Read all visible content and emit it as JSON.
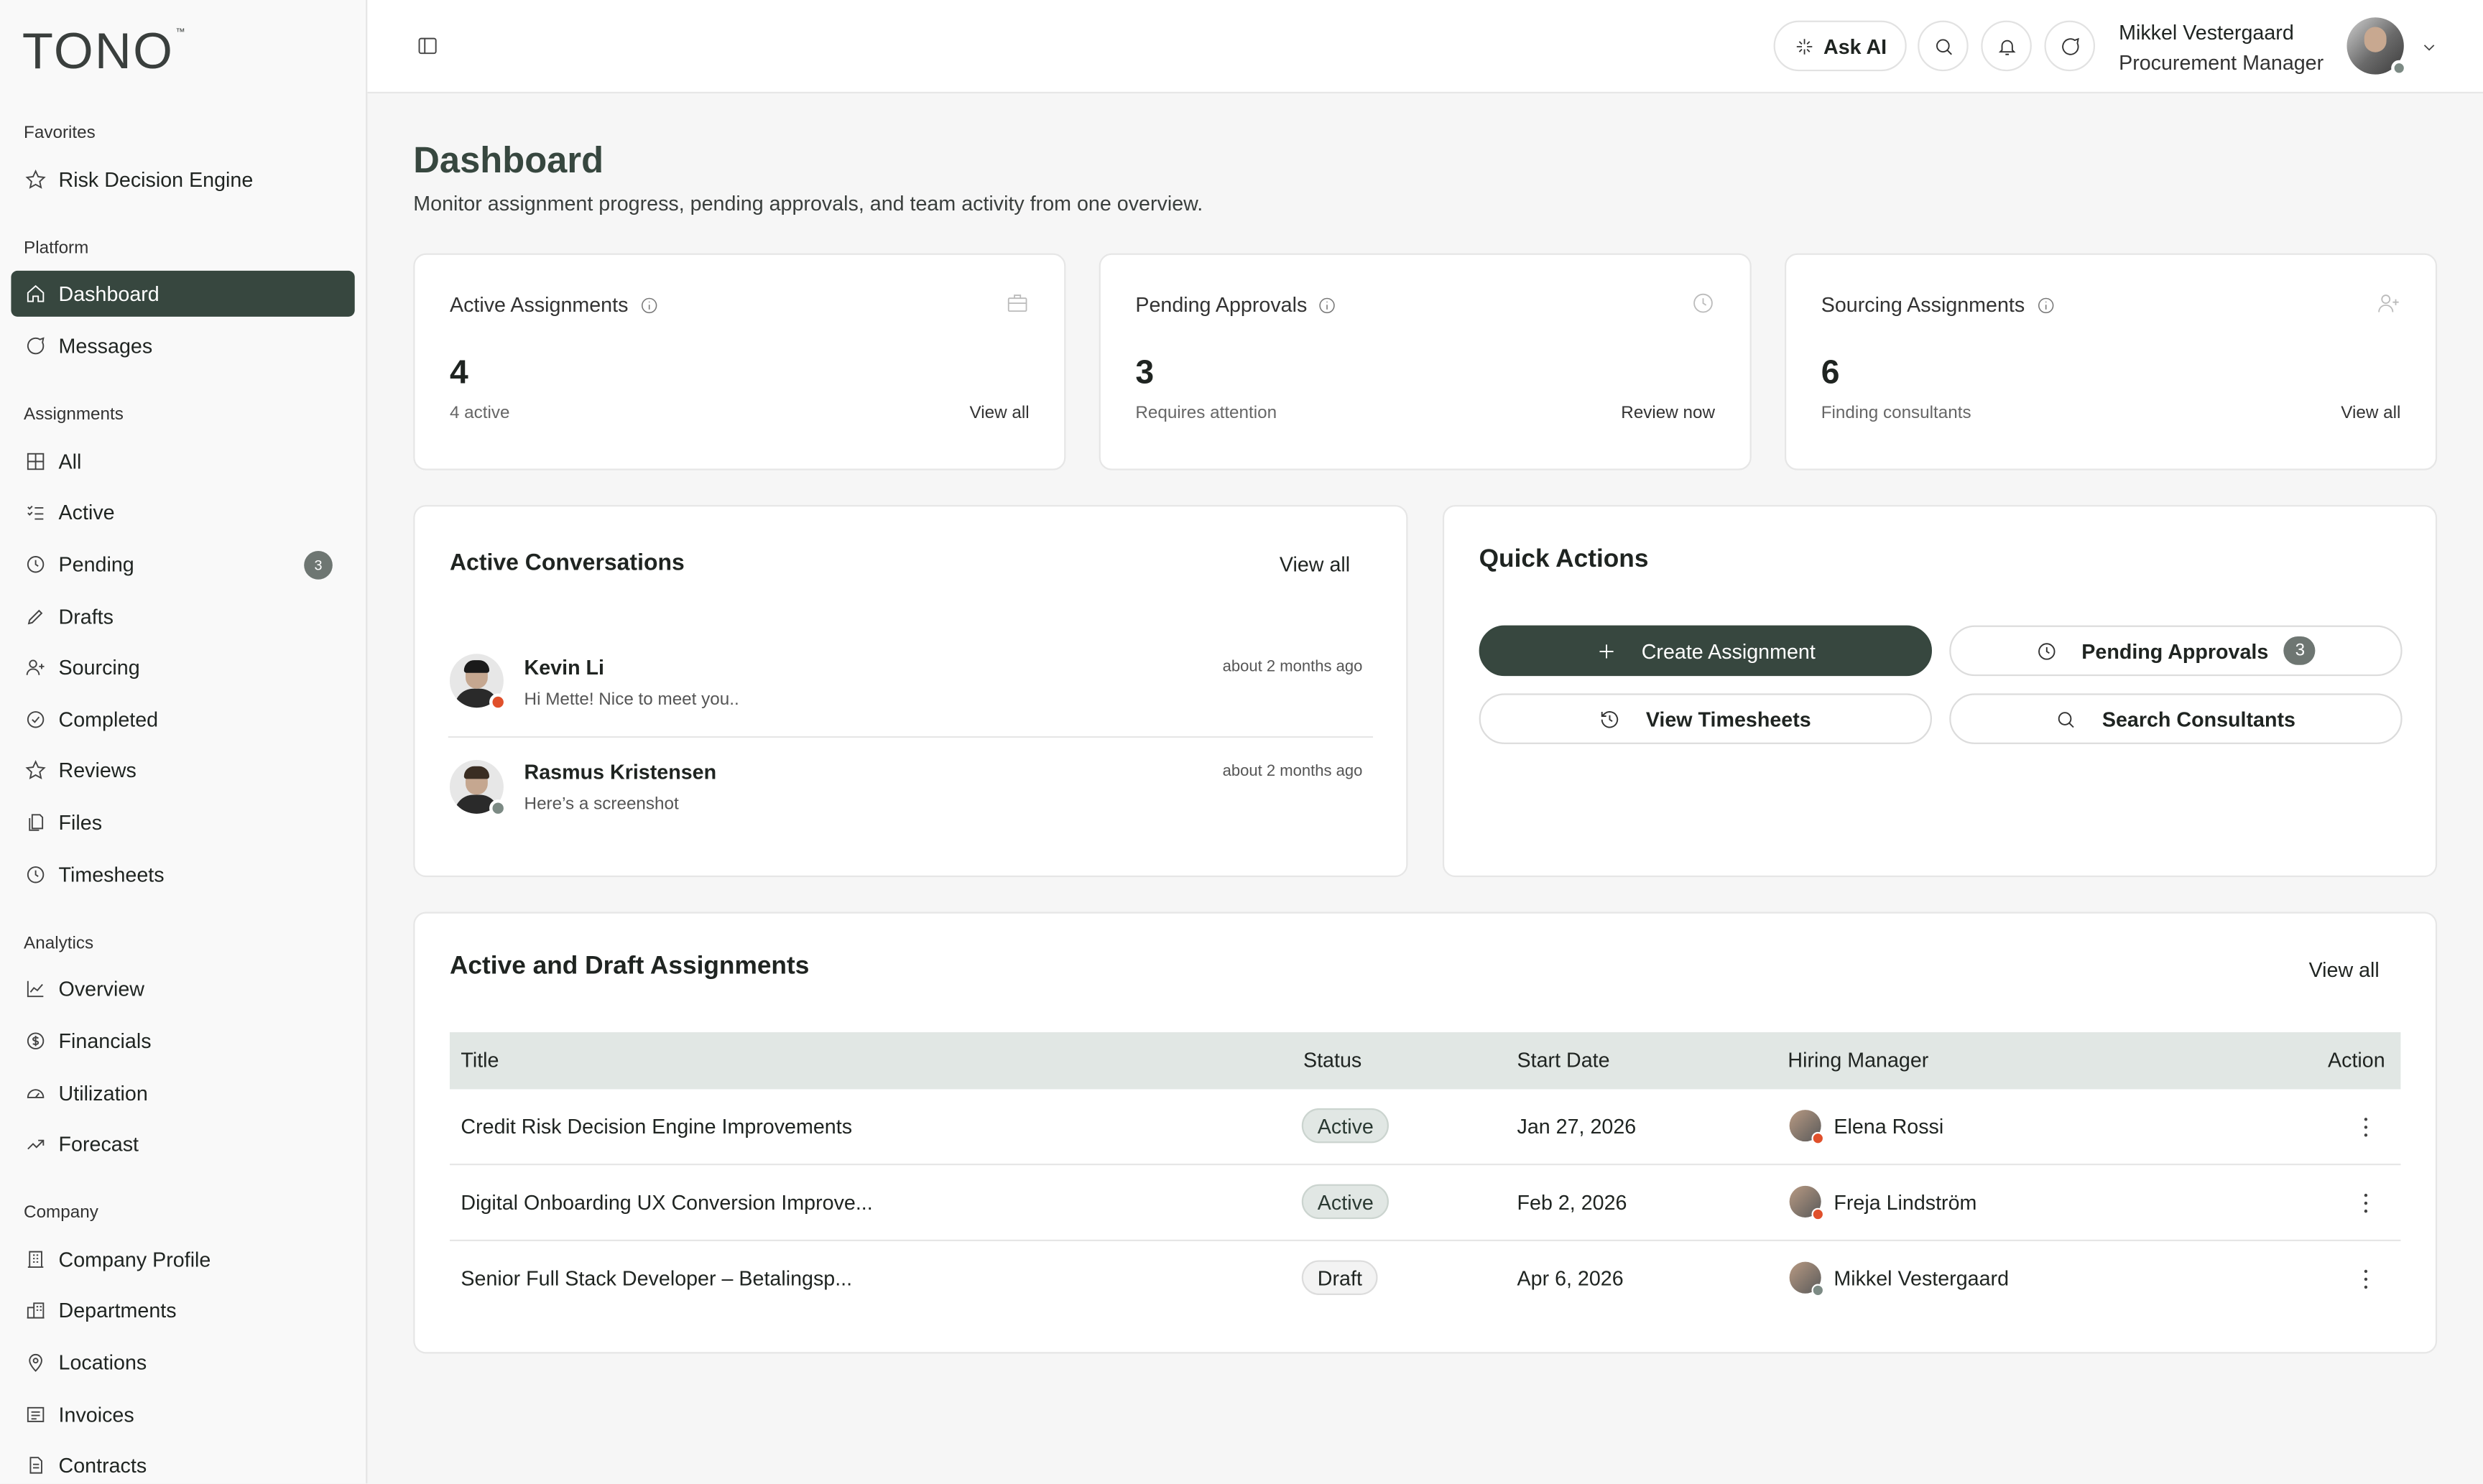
{
  "app": {
    "logo": "TONO",
    "logo_mark": "™"
  },
  "sidebar": {
    "sections": {
      "favorites": "Favorites",
      "platform": "Platform",
      "assignments": "Assignments",
      "analytics": "Analytics",
      "company": "Company"
    },
    "favorites": [
      {
        "label": "Risk Decision Engine",
        "icon": "star-icon"
      }
    ],
    "platform": [
      {
        "label": "Dashboard",
        "icon": "home-icon",
        "active": true
      },
      {
        "label": "Messages",
        "icon": "message-icon"
      }
    ],
    "assignments": [
      {
        "label": "All",
        "icon": "grid-icon"
      },
      {
        "label": "Active",
        "icon": "list-check-icon"
      },
      {
        "label": "Pending",
        "icon": "clock-icon",
        "badge": "3"
      },
      {
        "label": "Drafts",
        "icon": "pencil-icon"
      },
      {
        "label": "Sourcing",
        "icon": "user-plus-icon"
      },
      {
        "label": "Completed",
        "icon": "check-circle-icon"
      },
      {
        "label": "Reviews",
        "icon": "star-icon"
      },
      {
        "label": "Files",
        "icon": "files-icon"
      },
      {
        "label": "Timesheets",
        "icon": "clock-icon"
      }
    ],
    "analytics": [
      {
        "label": "Overview",
        "icon": "line-chart-icon"
      },
      {
        "label": "Financials",
        "icon": "dollar-icon"
      },
      {
        "label": "Utilization",
        "icon": "gauge-icon"
      },
      {
        "label": "Forecast",
        "icon": "trend-up-icon"
      }
    ],
    "company": [
      {
        "label": "Company Profile",
        "icon": "building-icon"
      },
      {
        "label": "Departments",
        "icon": "buildings-icon"
      },
      {
        "label": "Locations",
        "icon": "pin-icon"
      },
      {
        "label": "Invoices",
        "icon": "invoice-icon"
      },
      {
        "label": "Contracts",
        "icon": "document-icon"
      }
    ]
  },
  "header": {
    "ask_ai": "Ask AI",
    "user": {
      "name": "Mikkel Vestergaard",
      "role": "Procurement Manager"
    }
  },
  "page": {
    "title": "Dashboard",
    "subtitle": "Monitor assignment progress, pending approvals, and team activity from one overview."
  },
  "stats": [
    {
      "title": "Active Assignments",
      "value": "4",
      "caption": "4 active",
      "link": "View all",
      "icon": "briefcase-icon"
    },
    {
      "title": "Pending Approvals",
      "value": "3",
      "caption": "Requires attention",
      "link": "Review now",
      "icon": "clock-icon"
    },
    {
      "title": "Sourcing Assignments",
      "value": "6",
      "caption": "Finding consultants",
      "link": "View all",
      "icon": "user-plus-icon"
    }
  ],
  "conversations": {
    "title": "Active Conversations",
    "view_all": "View all",
    "items": [
      {
        "name": "Kevin Li",
        "message": "Hi Mette! Nice to meet you..",
        "time": "about 2 months ago",
        "status_color": "#e0502b"
      },
      {
        "name": "Rasmus Kristensen",
        "message": "Here’s a screenshot",
        "time": "about 2 months ago",
        "status_color": "#7c8a84"
      }
    ]
  },
  "quick_actions": {
    "title": "Quick Actions",
    "create": "Create Assignment",
    "pending": "Pending Approvals",
    "pending_badge": "3",
    "timesheets": "View Timesheets",
    "search": "Search Consultants"
  },
  "assignments_table": {
    "title": "Active and Draft Assignments",
    "view_all": "View all",
    "columns": {
      "title": "Title",
      "status": "Status",
      "start": "Start Date",
      "manager": "Hiring Manager",
      "action": "Action"
    },
    "rows": [
      {
        "title": "Credit Risk Decision Engine Improvements",
        "status": "Active",
        "start": "Jan 27, 2026",
        "manager": "Elena Rossi",
        "dot": "#e0502b"
      },
      {
        "title": "Digital Onboarding UX Conversion Improve...",
        "status": "Active",
        "start": "Feb 2, 2026",
        "manager": "Freja Lindström",
        "dot": "#e0502b"
      },
      {
        "title": "Senior Full Stack Developer – Betalingsp...",
        "status": "Draft",
        "start": "Apr 6, 2026",
        "manager": "Mikkel Vestergaard",
        "dot": "#7c8a84"
      }
    ]
  },
  "colors": {
    "accent": "#37473f",
    "alert": "#e0502b",
    "muted": "#7c8a84"
  }
}
